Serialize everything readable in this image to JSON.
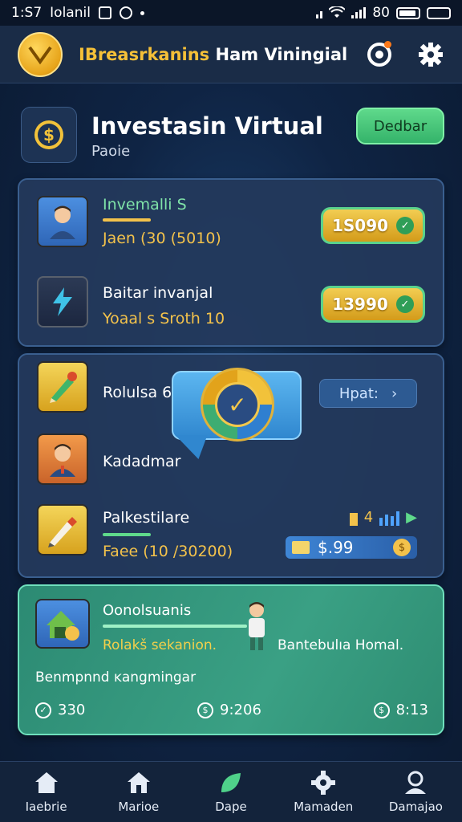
{
  "status_bar": {
    "time": "1:S7",
    "carrier": "Iolanil",
    "battery_text": "80"
  },
  "app_bar": {
    "title_part1": "IBreasrkanins",
    "title_part2": " Ham Viningial"
  },
  "hero": {
    "title": "Investasin Virtual",
    "subtitle": "Paoie",
    "action_label": "Dedbar"
  },
  "panel1": {
    "rows": [
      {
        "title": "Invemalli S",
        "sub": "Jaen (30 (5010)",
        "value": "1S090"
      },
      {
        "title": "Baitar invanjal",
        "sub": "Yoaal s Sroth 10",
        "value": "13990"
      }
    ]
  },
  "panel2": {
    "rows": [
      {
        "title": "Rolulsa 6/"
      },
      {
        "title": "Kadadmar"
      },
      {
        "title": "Palkestilare",
        "sub": "Faee (10 /30200)"
      }
    ],
    "tag_label": "Hpat:",
    "mini_stat": "4",
    "price": "$.99"
  },
  "panel3": {
    "title": "Oonolsuanis",
    "sub": "Rolakš sekanion.",
    "right_text": "Bantebulıa Homal.",
    "line": "Benmpnnd ĸangmingar",
    "stats": [
      "330",
      "9:206",
      "8:13"
    ]
  },
  "bottom_nav": {
    "items": [
      {
        "label": "Iaebrie",
        "icon": "home-icon"
      },
      {
        "label": "Marioe",
        "icon": "house-icon"
      },
      {
        "label": "Dape",
        "icon": "leaf-icon"
      },
      {
        "label": "Mamaden",
        "icon": "gear-icon"
      },
      {
        "label": "Damajao",
        "icon": "user-icon"
      }
    ]
  },
  "colors": {
    "accent_gold": "#f3c24b",
    "accent_green": "#5fd98b",
    "panel_bg": "#243a5c",
    "nav_bg": "#13233b"
  }
}
